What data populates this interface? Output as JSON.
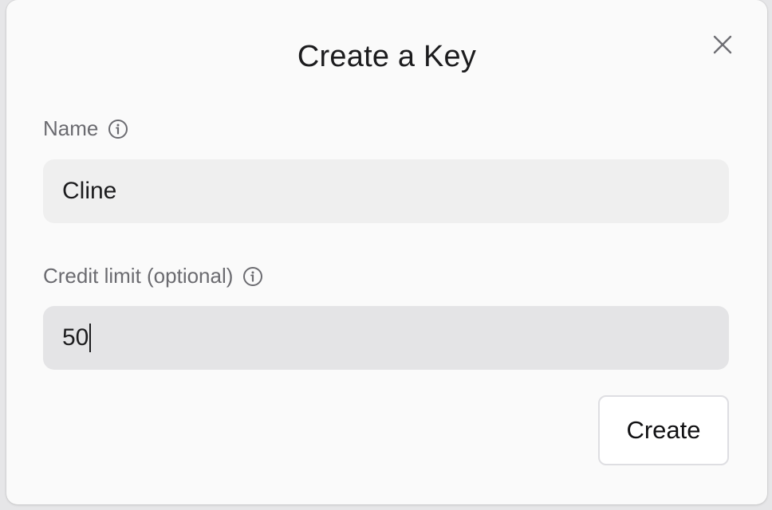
{
  "dialog": {
    "title": "Create a Key",
    "close_icon": "close-icon"
  },
  "fields": {
    "name": {
      "label": "Name",
      "value": "Cline",
      "info_icon": "info-icon"
    },
    "credit_limit": {
      "label": "Credit limit (optional)",
      "value": "50",
      "info_icon": "info-icon",
      "focused": true
    }
  },
  "actions": {
    "create_label": "Create"
  },
  "colors": {
    "dialog_bg": "#fafafa",
    "input_bg": "#efefef",
    "input_focused_bg": "#e4e4e6",
    "label_text": "#6b6b70",
    "primary_text": "#1c1c1e"
  }
}
